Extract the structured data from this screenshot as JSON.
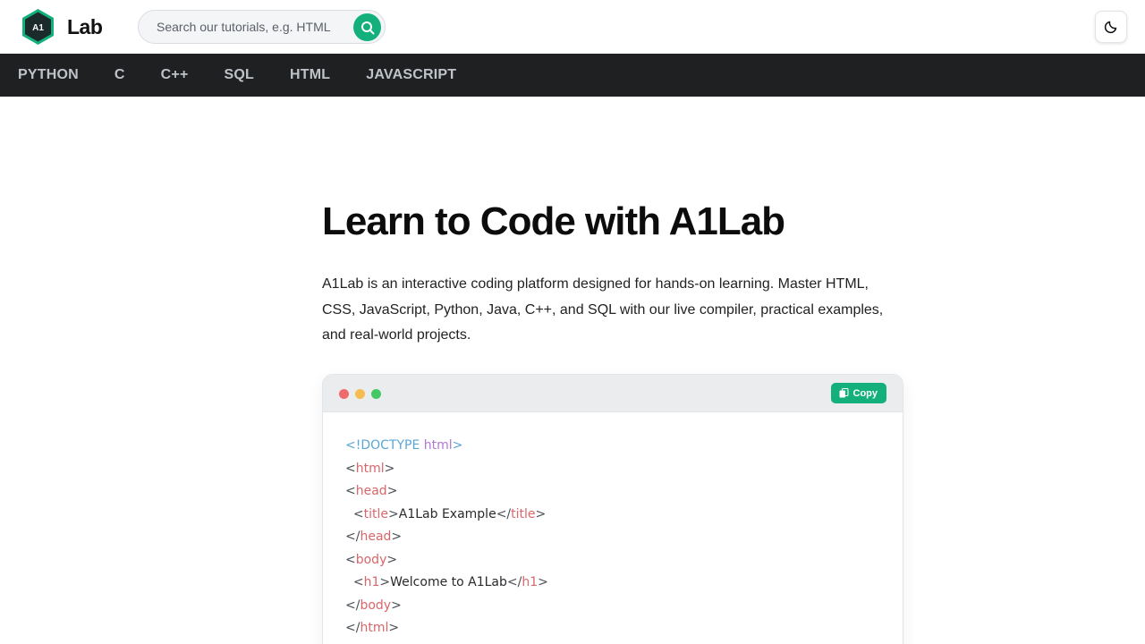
{
  "brand": {
    "badge": "A1",
    "name": "Lab",
    "accent": "#14b07c",
    "hex_fill": "#1b2a2a"
  },
  "search": {
    "placeholder": "Search our tutorials, e.g. HTML",
    "value": "",
    "icon": "search-icon"
  },
  "theme_toggle": {
    "icon": "moon-icon"
  },
  "nav": {
    "items": [
      {
        "label": "PYTHON"
      },
      {
        "label": "C"
      },
      {
        "label": "C++"
      },
      {
        "label": "SQL"
      },
      {
        "label": "HTML"
      },
      {
        "label": "JAVASCRIPT"
      }
    ]
  },
  "main": {
    "title": "Learn to Code with A1Lab",
    "intro": "A1Lab is an interactive coding platform designed for hands-on learning. Master HTML, CSS, JavaScript, Python, Java, C++, and SQL with our live compiler, practical examples, and real-world projects."
  },
  "code_card": {
    "copy_label": "Copy",
    "copy_icon": "copy-icon",
    "lines": [
      [
        {
          "t": "<!DOCTYPE ",
          "c": "doctype"
        },
        {
          "t": "html",
          "c": "kw"
        },
        {
          "t": ">",
          "c": "doctype"
        }
      ],
      [
        {
          "t": "<",
          "c": "punct"
        },
        {
          "t": "html",
          "c": "tag"
        },
        {
          "t": ">",
          "c": "punct"
        }
      ],
      [
        {
          "t": "<",
          "c": "punct"
        },
        {
          "t": "head",
          "c": "tag"
        },
        {
          "t": ">",
          "c": "punct"
        }
      ],
      [
        {
          "t": "  <",
          "c": "punct"
        },
        {
          "t": "title",
          "c": "tag"
        },
        {
          "t": ">",
          "c": "punct"
        },
        {
          "t": "A1Lab Example",
          "c": "text"
        },
        {
          "t": "</",
          "c": "punct"
        },
        {
          "t": "title",
          "c": "tag"
        },
        {
          "t": ">",
          "c": "punct"
        }
      ],
      [
        {
          "t": "</",
          "c": "punct"
        },
        {
          "t": "head",
          "c": "tag"
        },
        {
          "t": ">",
          "c": "punct"
        }
      ],
      [
        {
          "t": "<",
          "c": "punct"
        },
        {
          "t": "body",
          "c": "tag"
        },
        {
          "t": ">",
          "c": "punct"
        }
      ],
      [
        {
          "t": "  <",
          "c": "punct"
        },
        {
          "t": "h1",
          "c": "tag"
        },
        {
          "t": ">",
          "c": "punct"
        },
        {
          "t": "Welcome to A1Lab",
          "c": "text"
        },
        {
          "t": "</",
          "c": "punct"
        },
        {
          "t": "h1",
          "c": "tag"
        },
        {
          "t": ">",
          "c": "punct"
        }
      ],
      [
        {
          "t": "</",
          "c": "punct"
        },
        {
          "t": "body",
          "c": "tag"
        },
        {
          "t": ">",
          "c": "punct"
        }
      ],
      [
        {
          "t": "</",
          "c": "punct"
        },
        {
          "t": "html",
          "c": "tag"
        },
        {
          "t": ">",
          "c": "punct"
        }
      ]
    ]
  }
}
